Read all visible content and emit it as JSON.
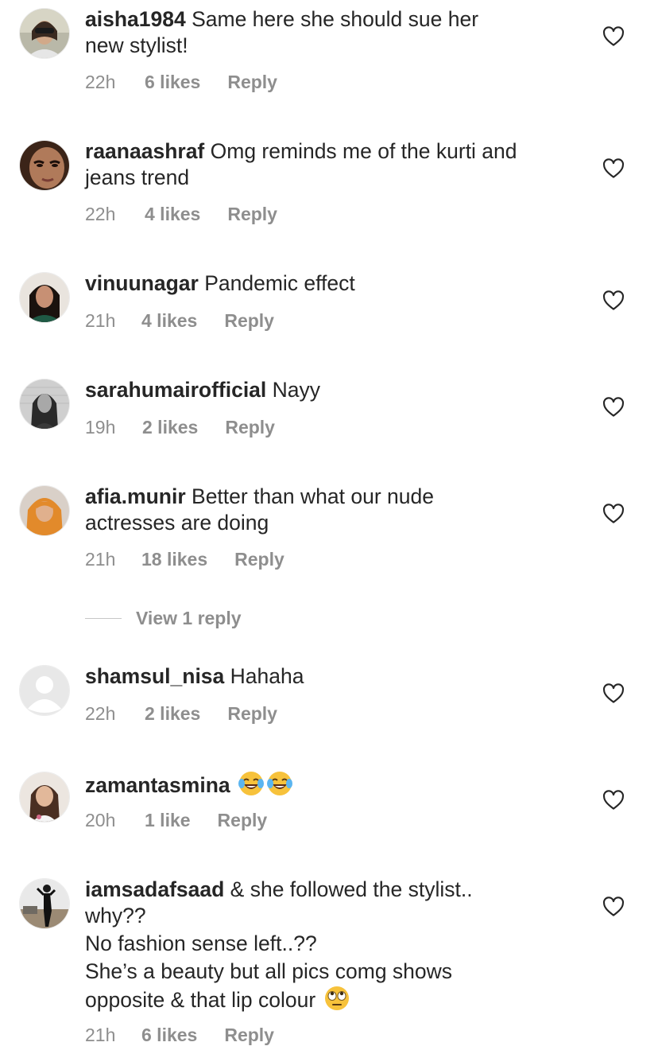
{
  "comments": [
    {
      "username": "aisha1984",
      "lines": [
        "Same here she should sue her",
        "new stylist!"
      ],
      "time": "22h",
      "likes": "6 likes",
      "reply": "Reply",
      "avatar": "woman-sunglasses"
    },
    {
      "username": "raanaashraf",
      "lines": [
        "Omg reminds me of the kurti and",
        "jeans trend"
      ],
      "time": "22h",
      "likes": "4 likes",
      "reply": "Reply",
      "avatar": "face-closeup"
    },
    {
      "username": "vinuunagar",
      "lines": [
        "Pandemic effect"
      ],
      "time": "21h",
      "likes": "4 likes",
      "reply": "Reply",
      "avatar": "woman-dark-hair"
    },
    {
      "username": "sarahumairofficial",
      "lines": [
        "Nayy"
      ],
      "time": "19h",
      "likes": "2 likes",
      "reply": "Reply",
      "avatar": "woman-grey"
    },
    {
      "username": "afia.munir",
      "lines": [
        "Better than what our nude",
        "actresses are doing"
      ],
      "time": "21h",
      "likes": "18 likes",
      "reply": "Reply",
      "avatar": "woman-orange-scarf"
    },
    {
      "username": "shamsul_nisa",
      "lines": [
        "Hahaha"
      ],
      "time": "22h",
      "likes": "2 likes",
      "reply": "Reply",
      "avatar": "default-avatar"
    },
    {
      "username": "zamantasmina",
      "lines": [
        ""
      ],
      "time": "20h",
      "likes": "1 like",
      "reply": "Reply",
      "avatar": "woman-light",
      "emojis": [
        "face-with-tears-of-joy",
        "face-with-tears-of-joy"
      ]
    },
    {
      "username": "iamsadafsaad",
      "lines": [
        "& she followed the stylist..",
        "why??",
        "No fashion sense left..??",
        "She’s a beauty but all pics comg shows",
        "opposite & that lip colour"
      ],
      "time": "21h",
      "likes": "6 likes",
      "reply": "Reply",
      "avatar": "person-standing",
      "trailing_emoji": "face-with-rolling-eyes"
    }
  ],
  "view_replies": {
    "label": "View 1 reply"
  },
  "icons": {
    "like": "heart-outline-icon"
  },
  "colors": {
    "text": "#262626",
    "meta": "#8e8e8e",
    "heart_stroke": "#262626"
  }
}
